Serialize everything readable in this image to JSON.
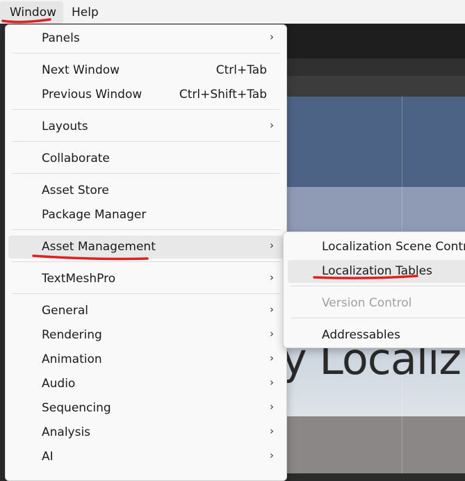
{
  "menubar": {
    "items": [
      {
        "label": "Window",
        "active": true
      },
      {
        "label": "Help"
      }
    ]
  },
  "window_menu": {
    "items": [
      {
        "label": "Panels",
        "submenu": true
      },
      {
        "label": "Next Window",
        "shortcut": "Ctrl+Tab"
      },
      {
        "label": "Previous Window",
        "shortcut": "Ctrl+Shift+Tab"
      },
      {
        "label": "Layouts",
        "submenu": true
      },
      {
        "label": "Collaborate"
      },
      {
        "label": "Asset Store"
      },
      {
        "label": "Package Manager"
      },
      {
        "label": "Asset Management",
        "submenu": true,
        "highlighted": true
      },
      {
        "label": "TextMeshPro",
        "submenu": true
      },
      {
        "label": "General",
        "submenu": true
      },
      {
        "label": "Rendering",
        "submenu": true
      },
      {
        "label": "Animation",
        "submenu": true
      },
      {
        "label": "Audio",
        "submenu": true
      },
      {
        "label": "Sequencing",
        "submenu": true
      },
      {
        "label": "Analysis",
        "submenu": true
      },
      {
        "label": "AI",
        "submenu": true
      }
    ],
    "arrow_glyph": "›"
  },
  "asset_management_submenu": {
    "items": [
      {
        "label": "Localization Scene Controls"
      },
      {
        "label": "Localization Tables",
        "highlighted": true
      },
      {
        "label": "Version Control",
        "disabled": true
      },
      {
        "label": "Addressables"
      }
    ]
  },
  "background": {
    "scene_text": "y Localiz"
  },
  "colors": {
    "annotation": "#e02020",
    "highlight": "#e8e8e8",
    "scene_blue": "#4d6386"
  }
}
